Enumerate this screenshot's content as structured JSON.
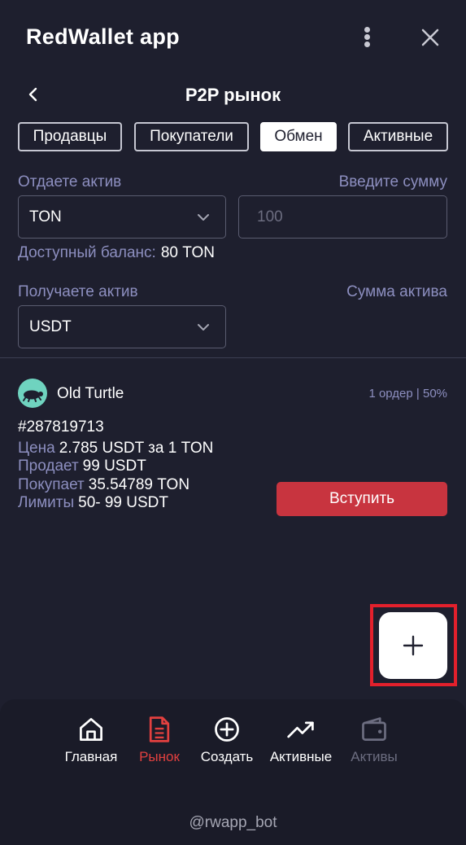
{
  "header": {
    "app_title": "RedWallet app"
  },
  "page": {
    "title": "P2P рынок"
  },
  "tabs": [
    {
      "label": "Продавцы",
      "active": false
    },
    {
      "label": "Покупатели",
      "active": false
    },
    {
      "label": "Обмен",
      "active": true
    },
    {
      "label": "Активные",
      "active": false
    }
  ],
  "form": {
    "give_label": "Отдаете актив",
    "amount_label": "Введите сумму",
    "give_asset": "TON",
    "amount_placeholder": "100",
    "amount_value": "",
    "balance_label": "Доступный баланс:",
    "balance_value": "80 TON",
    "receive_label": "Получаете актив",
    "receive_amount_label": "Сумма актива",
    "receive_asset": "USDT"
  },
  "order": {
    "user": "Old Turtle",
    "meta": "1 ордер | 50%",
    "id": "#287819713",
    "price_label": "Цена",
    "price_value": "2.785 USDT за 1 TON",
    "sells_label": "Продает",
    "sells_value": "99 USDT",
    "buys_label": "Покупает",
    "buys_value": "35.54789 TON",
    "limits_label": "Лимиты",
    "limits_value": "50- 99 USDT",
    "join_label": "Вступить"
  },
  "nav": [
    {
      "label": "Главная",
      "icon": "home-icon",
      "color": "#ffffff"
    },
    {
      "label": "Рынок",
      "icon": "document-icon",
      "color": "#e2403f"
    },
    {
      "label": "Создать",
      "icon": "plus-circle-icon",
      "color": "#ffffff"
    },
    {
      "label": "Активные",
      "icon": "trending-up-icon",
      "color": "#ffffff"
    },
    {
      "label": "Активы",
      "icon": "wallet-icon",
      "color": "#6c6d80"
    }
  ],
  "footer": "@rwapp_bot",
  "colors": {
    "accent": "#c8343f",
    "nav_active": "#e2403f",
    "muted": "#8d8fc0",
    "background": "#1e1f2e"
  }
}
